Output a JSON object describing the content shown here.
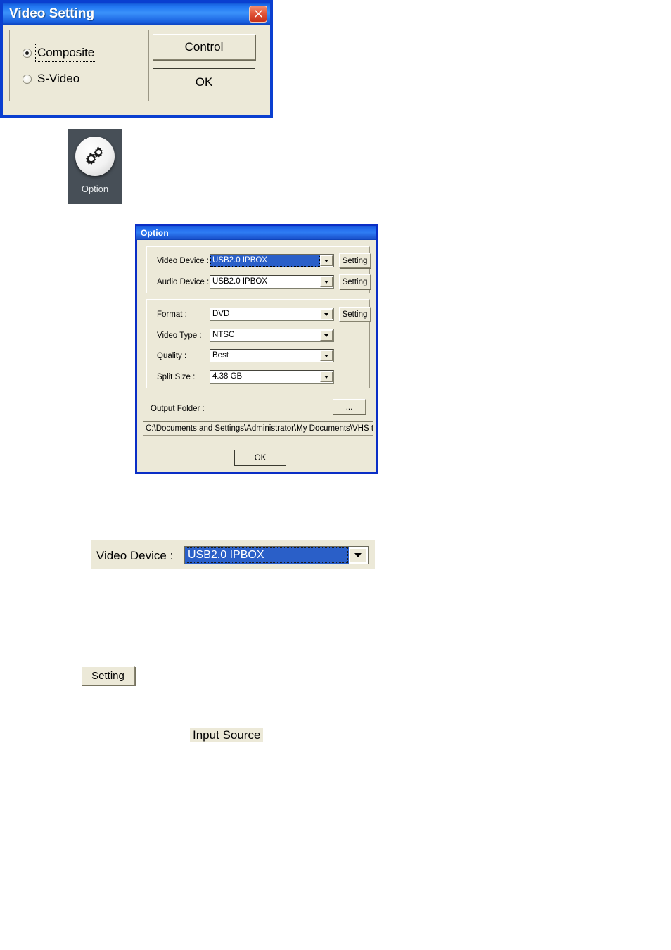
{
  "toolbar_icon": {
    "label": "Option",
    "icon": "gears-icon"
  },
  "option_dialog": {
    "title": "Option",
    "devices": {
      "video_device_label": "Video Device :",
      "video_device_value": "USB2.0 IPBOX",
      "video_device_setting_label": "Setting",
      "audio_device_label": "Audio Device :",
      "audio_device_value": "USB2.0 IPBOX",
      "audio_device_setting_label": "Setting"
    },
    "format": {
      "format_label": "Format :",
      "format_value": "DVD",
      "format_setting_label": "Setting",
      "video_type_label": "Video Type :",
      "video_type_value": "NTSC",
      "quality_label": "Quality :",
      "quality_value": "Best",
      "split_size_label": "Split Size :",
      "split_size_value": "4.38 GB"
    },
    "output": {
      "label": "Output Folder :",
      "browse_label": "...",
      "path": "C:\\Documents and Settings\\Administrator\\My Documents\\VHS to DVD\\"
    },
    "ok_label": "OK"
  },
  "video_device_row": {
    "label": "Video Device :",
    "value": "USB2.0 IPBOX"
  },
  "setting_button": {
    "label": "Setting"
  },
  "video_setting_dialog": {
    "title": "Video Setting",
    "close_icon": "close-icon",
    "group_title": "Input Source",
    "options": [
      {
        "label": "Composite",
        "selected": true
      },
      {
        "label": "S-Video",
        "selected": false
      }
    ],
    "control_label": "Control",
    "ok_label": "OK"
  },
  "colors": {
    "titlebar_blue": "#1d63e8",
    "dialog_face": "#ece9d8",
    "selection_blue": "#2a5fc8",
    "close_red": "#c62f18",
    "toolbar_tile": "#474f57"
  }
}
